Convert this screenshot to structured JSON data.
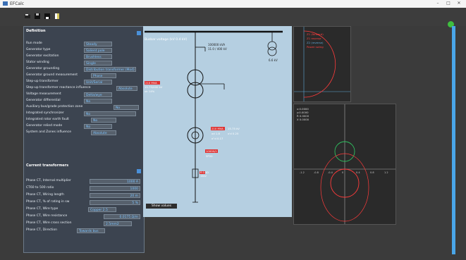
{
  "window": {
    "title": "EFCalc",
    "min": "–",
    "max": "□",
    "close": "✕"
  },
  "toolbar": {
    "icons": [
      "cut-icon",
      "save-icon",
      "save-as-icon",
      "document-icon"
    ]
  },
  "definition": {
    "title": "Definition",
    "rows": [
      {
        "label": "Run mode",
        "value": "Steady"
      },
      {
        "label": "Generator type",
        "value": "Salient pole"
      },
      {
        "label": "Generator excitation",
        "value": "Brushless"
      },
      {
        "label": "Stator winding",
        "value": "Single"
      },
      {
        "label": "Generator grounding",
        "value": "Distribution transformer (Mod)"
      },
      {
        "label": "Generator ground measurement",
        "value": "Phase"
      },
      {
        "label": "Step-up transformer",
        "value": "Unit/Serial"
      },
      {
        "label": "Step-up transformer reactance influence",
        "value": "Absolute"
      },
      {
        "label": "Voltage measurement",
        "value": "Delta/wye"
      },
      {
        "label": "Generator differential",
        "value": "No"
      },
      {
        "label": "Auxiliary bus/grade protection zone",
        "value": "No"
      },
      {
        "label": "Integrated synchronizer",
        "value": "No"
      },
      {
        "label": "Integrated rotor earth fault",
        "value": "No"
      },
      {
        "label": "Generator relied mode",
        "value": "No"
      },
      {
        "label": "System and Zones influence",
        "value": "Absolute"
      }
    ]
  },
  "current": {
    "title": "Current transformers",
    "rows": [
      {
        "label": "Phase CT, Internal multiplier",
        "value": "1000 A"
      },
      {
        "label": "CT60 to 500 ratio",
        "value": "1000"
      },
      {
        "label": "Phase CT, Wiring length",
        "value": "20 m"
      },
      {
        "label": "Phase CT, % of rating in sw",
        "value": "5 %"
      },
      {
        "label": "Phase CT, Wire type",
        "value": "Copper 2.5"
      },
      {
        "label": "Phase CT, Wire resistance",
        "value": "0.0175 Ω/m"
      },
      {
        "label": "Phase CT, Wire cross section",
        "value": "2.5mm2"
      },
      {
        "label": "Phase CT, Direction",
        "value": "Towards bus"
      }
    ]
  },
  "schematic": {
    "bus_label": "Busbar voltage (kV 0.4 kV)",
    "tr_vals": [
      "100000 kVA",
      "11.0 / 400 kV"
    ],
    "aux_vals": [
      "6.6 kV"
    ],
    "unit_vals": [
      "210 MVA",
      "15.75/400 kV",
      "uk 14%"
    ],
    "gen_vals": [
      "210 MVA",
      "15.75 kV",
      "xd 1.8",
      "x'd 0.25",
      "x''d 0.17"
    ],
    "ct_vals": [
      "10000/1",
      "5P20"
    ],
    "ground_vals": [
      "R 0.5Ω",
      "15kV"
    ],
    "button": "Show values"
  },
  "plot1": {
    "labels": [
      "Z1 (forward)",
      "Z1 reverse",
      "Z2 (reverse)",
      "Power swing"
    ]
  },
  "plot2": {
    "labels": [
      "x:0.0000",
      "y:0.0000",
      "R 0.0000",
      "X 0.0000"
    ],
    "tick_labels": [
      "-1.2",
      "-0.8",
      "-0.4",
      "0",
      "0.4",
      "0.8",
      "1.2"
    ]
  },
  "colors": {
    "accent": "#4aa6e8",
    "status": "#3fbf3f",
    "schematic_bg": "#b5cfe1"
  }
}
